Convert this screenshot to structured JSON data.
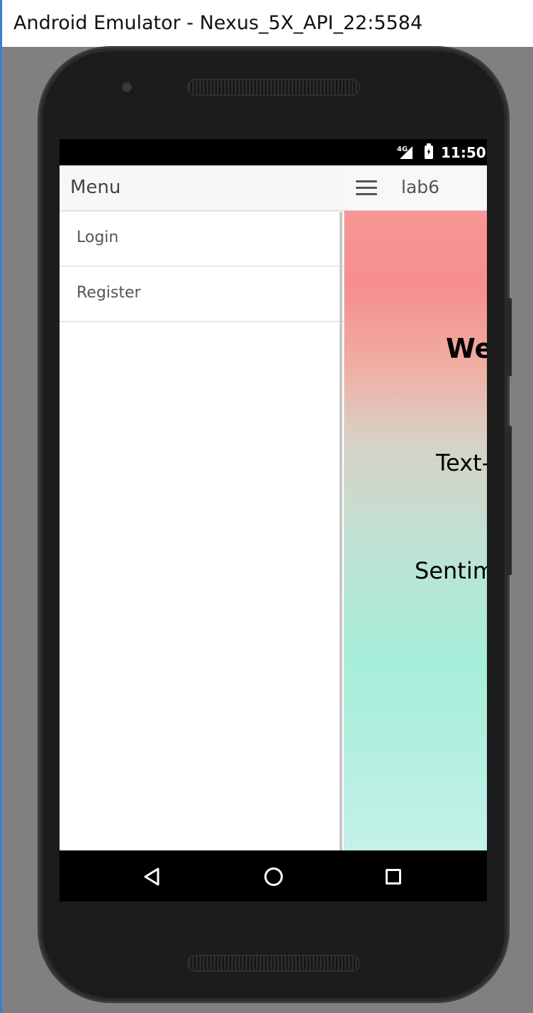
{
  "window": {
    "title": "Android Emulator - Nexus_5X_API_22:5584"
  },
  "statusbar": {
    "network": "4G",
    "time": "11:50"
  },
  "drawer": {
    "title": "Menu",
    "items": [
      {
        "label": "Login"
      },
      {
        "label": "Register"
      }
    ]
  },
  "navbar": {
    "brand": "lab6"
  },
  "main": {
    "welcome": "Wel",
    "line2": "Text-t",
    "line3": "Sentime"
  },
  "icons": {
    "hamburger": "menu-icon",
    "back": "back-icon",
    "home": "home-icon",
    "recent": "recent-apps-icon"
  },
  "colors": {
    "gradient_top": "#f68f8e",
    "gradient_bottom": "#a6eeda",
    "navbar_bg": "#f8f8f8"
  }
}
